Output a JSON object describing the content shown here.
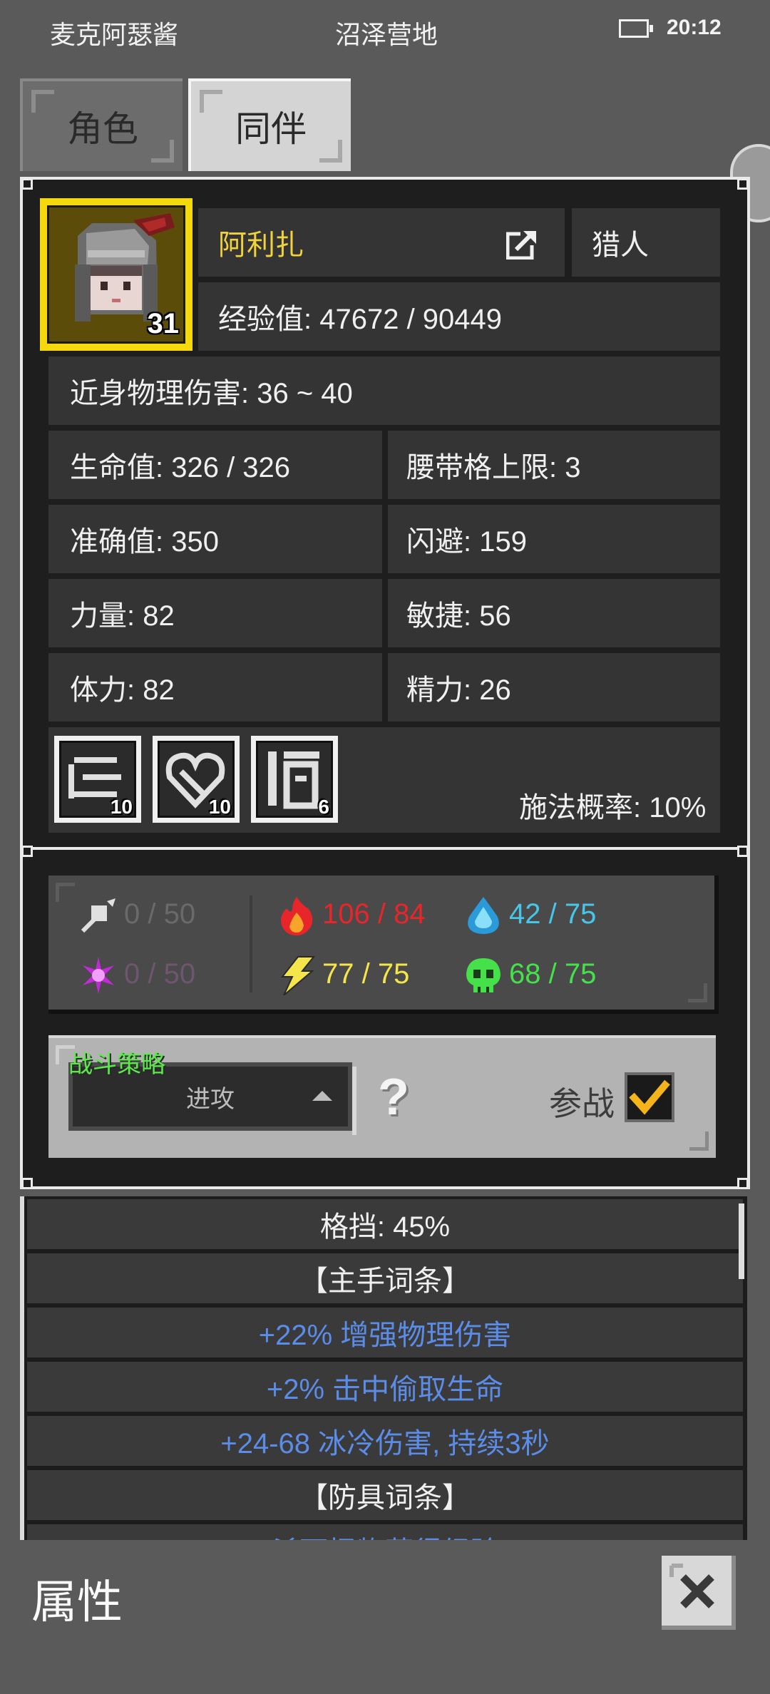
{
  "status_bar": {
    "left_text": "麦克阿瑟酱",
    "location": "沼泽营地",
    "time": "20:12"
  },
  "tabs": [
    {
      "label": "角色"
    },
    {
      "label": "同伴"
    }
  ],
  "character": {
    "name": "阿利扎",
    "class": "猎人",
    "level": "31",
    "exp": "经验值: 47672 / 90449"
  },
  "stats": {
    "melee": "近身物理伤害: 36 ~ 40",
    "hp": "生命值: 326 / 326",
    "belt": "腰带格上限: 3",
    "accuracy": "准确值: 350",
    "dodge": "闪避: 159",
    "strength": "力量: 82",
    "agility": "敏捷: 56",
    "stamina": "体力: 82",
    "energy": "精力: 26",
    "cast_chance": "施法概率: 10%"
  },
  "skills": [
    {
      "count": "10"
    },
    {
      "count": "10"
    },
    {
      "count": "6"
    }
  ],
  "resistances": {
    "physical": "0 / 50",
    "magic": "0 / 50",
    "fire": "106 / 84",
    "lightning": "77 / 75",
    "cold": "42 / 75",
    "poison": "68 / 75",
    "colors": {
      "fire": "#e8262a",
      "lightning": "#f4e64a",
      "cold": "#46c6e8",
      "poison": "#46e04a",
      "disabled": "#6a6a6a",
      "magic_disabled": "#6e566e"
    }
  },
  "strategy": {
    "label": "战斗策略",
    "selected": "进攻",
    "help": "?",
    "join_label": "参战"
  },
  "list": [
    {
      "text": "格挡: 45%",
      "color": "#f0f0f0"
    },
    {
      "text": "【主手词条】",
      "color": "#f0f0f0"
    },
    {
      "text": "+22% 增强物理伤害",
      "color": "#5b8ce8"
    },
    {
      "text": "+2% 击中偷取生命",
      "color": "#5b8ce8"
    },
    {
      "text": "+24-68 冰冷伤害, 持续3秒",
      "color": "#5b8ce8"
    },
    {
      "text": "【防具词条】",
      "color": "#f0f0f0"
    },
    {
      "text": "杀死怪物获得经验",
      "color": "#5b8ce8"
    }
  ],
  "bottom": {
    "title": "属性"
  },
  "colors": {
    "name": "#f0d23a",
    "accent_frame": "#eaeaea"
  }
}
